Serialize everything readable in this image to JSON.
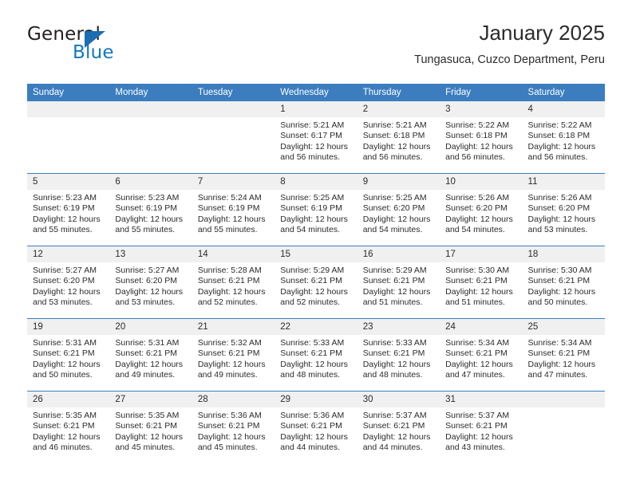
{
  "brand": {
    "name_top": "General",
    "name_bottom": "Blue",
    "accent_color": "#1b6cb0",
    "text_color": "#231f20",
    "blue_text_color": "#1278be"
  },
  "header": {
    "title": "January 2025",
    "subtitle": "Tungasuca, Cuzco Department, Peru"
  },
  "calendar": {
    "header_bg": "#3b7dbf",
    "header_fg": "#ffffff",
    "daynum_bg": "#f0f0f0",
    "weekday_headers": [
      "Sunday",
      "Monday",
      "Tuesday",
      "Wednesday",
      "Thursday",
      "Friday",
      "Saturday"
    ],
    "weeks": [
      [
        {
          "day": "",
          "lines": []
        },
        {
          "day": "",
          "lines": []
        },
        {
          "day": "",
          "lines": []
        },
        {
          "day": "1",
          "lines": [
            "Sunrise: 5:21 AM",
            "Sunset: 6:17 PM",
            "Daylight: 12 hours",
            "and 56 minutes."
          ]
        },
        {
          "day": "2",
          "lines": [
            "Sunrise: 5:21 AM",
            "Sunset: 6:18 PM",
            "Daylight: 12 hours",
            "and 56 minutes."
          ]
        },
        {
          "day": "3",
          "lines": [
            "Sunrise: 5:22 AM",
            "Sunset: 6:18 PM",
            "Daylight: 12 hours",
            "and 56 minutes."
          ]
        },
        {
          "day": "4",
          "lines": [
            "Sunrise: 5:22 AM",
            "Sunset: 6:18 PM",
            "Daylight: 12 hours",
            "and 56 minutes."
          ]
        }
      ],
      [
        {
          "day": "5",
          "lines": [
            "Sunrise: 5:23 AM",
            "Sunset: 6:19 PM",
            "Daylight: 12 hours",
            "and 55 minutes."
          ]
        },
        {
          "day": "6",
          "lines": [
            "Sunrise: 5:23 AM",
            "Sunset: 6:19 PM",
            "Daylight: 12 hours",
            "and 55 minutes."
          ]
        },
        {
          "day": "7",
          "lines": [
            "Sunrise: 5:24 AM",
            "Sunset: 6:19 PM",
            "Daylight: 12 hours",
            "and 55 minutes."
          ]
        },
        {
          "day": "8",
          "lines": [
            "Sunrise: 5:25 AM",
            "Sunset: 6:19 PM",
            "Daylight: 12 hours",
            "and 54 minutes."
          ]
        },
        {
          "day": "9",
          "lines": [
            "Sunrise: 5:25 AM",
            "Sunset: 6:20 PM",
            "Daylight: 12 hours",
            "and 54 minutes."
          ]
        },
        {
          "day": "10",
          "lines": [
            "Sunrise: 5:26 AM",
            "Sunset: 6:20 PM",
            "Daylight: 12 hours",
            "and 54 minutes."
          ]
        },
        {
          "day": "11",
          "lines": [
            "Sunrise: 5:26 AM",
            "Sunset: 6:20 PM",
            "Daylight: 12 hours",
            "and 53 minutes."
          ]
        }
      ],
      [
        {
          "day": "12",
          "lines": [
            "Sunrise: 5:27 AM",
            "Sunset: 6:20 PM",
            "Daylight: 12 hours",
            "and 53 minutes."
          ]
        },
        {
          "day": "13",
          "lines": [
            "Sunrise: 5:27 AM",
            "Sunset: 6:20 PM",
            "Daylight: 12 hours",
            "and 53 minutes."
          ]
        },
        {
          "day": "14",
          "lines": [
            "Sunrise: 5:28 AM",
            "Sunset: 6:21 PM",
            "Daylight: 12 hours",
            "and 52 minutes."
          ]
        },
        {
          "day": "15",
          "lines": [
            "Sunrise: 5:29 AM",
            "Sunset: 6:21 PM",
            "Daylight: 12 hours",
            "and 52 minutes."
          ]
        },
        {
          "day": "16",
          "lines": [
            "Sunrise: 5:29 AM",
            "Sunset: 6:21 PM",
            "Daylight: 12 hours",
            "and 51 minutes."
          ]
        },
        {
          "day": "17",
          "lines": [
            "Sunrise: 5:30 AM",
            "Sunset: 6:21 PM",
            "Daylight: 12 hours",
            "and 51 minutes."
          ]
        },
        {
          "day": "18",
          "lines": [
            "Sunrise: 5:30 AM",
            "Sunset: 6:21 PM",
            "Daylight: 12 hours",
            "and 50 minutes."
          ]
        }
      ],
      [
        {
          "day": "19",
          "lines": [
            "Sunrise: 5:31 AM",
            "Sunset: 6:21 PM",
            "Daylight: 12 hours",
            "and 50 minutes."
          ]
        },
        {
          "day": "20",
          "lines": [
            "Sunrise: 5:31 AM",
            "Sunset: 6:21 PM",
            "Daylight: 12 hours",
            "and 49 minutes."
          ]
        },
        {
          "day": "21",
          "lines": [
            "Sunrise: 5:32 AM",
            "Sunset: 6:21 PM",
            "Daylight: 12 hours",
            "and 49 minutes."
          ]
        },
        {
          "day": "22",
          "lines": [
            "Sunrise: 5:33 AM",
            "Sunset: 6:21 PM",
            "Daylight: 12 hours",
            "and 48 minutes."
          ]
        },
        {
          "day": "23",
          "lines": [
            "Sunrise: 5:33 AM",
            "Sunset: 6:21 PM",
            "Daylight: 12 hours",
            "and 48 minutes."
          ]
        },
        {
          "day": "24",
          "lines": [
            "Sunrise: 5:34 AM",
            "Sunset: 6:21 PM",
            "Daylight: 12 hours",
            "and 47 minutes."
          ]
        },
        {
          "day": "25",
          "lines": [
            "Sunrise: 5:34 AM",
            "Sunset: 6:21 PM",
            "Daylight: 12 hours",
            "and 47 minutes."
          ]
        }
      ],
      [
        {
          "day": "26",
          "lines": [
            "Sunrise: 5:35 AM",
            "Sunset: 6:21 PM",
            "Daylight: 12 hours",
            "and 46 minutes."
          ]
        },
        {
          "day": "27",
          "lines": [
            "Sunrise: 5:35 AM",
            "Sunset: 6:21 PM",
            "Daylight: 12 hours",
            "and 45 minutes."
          ]
        },
        {
          "day": "28",
          "lines": [
            "Sunrise: 5:36 AM",
            "Sunset: 6:21 PM",
            "Daylight: 12 hours",
            "and 45 minutes."
          ]
        },
        {
          "day": "29",
          "lines": [
            "Sunrise: 5:36 AM",
            "Sunset: 6:21 PM",
            "Daylight: 12 hours",
            "and 44 minutes."
          ]
        },
        {
          "day": "30",
          "lines": [
            "Sunrise: 5:37 AM",
            "Sunset: 6:21 PM",
            "Daylight: 12 hours",
            "and 44 minutes."
          ]
        },
        {
          "day": "31",
          "lines": [
            "Sunrise: 5:37 AM",
            "Sunset: 6:21 PM",
            "Daylight: 12 hours",
            "and 43 minutes."
          ]
        },
        {
          "day": "",
          "lines": []
        }
      ]
    ]
  }
}
